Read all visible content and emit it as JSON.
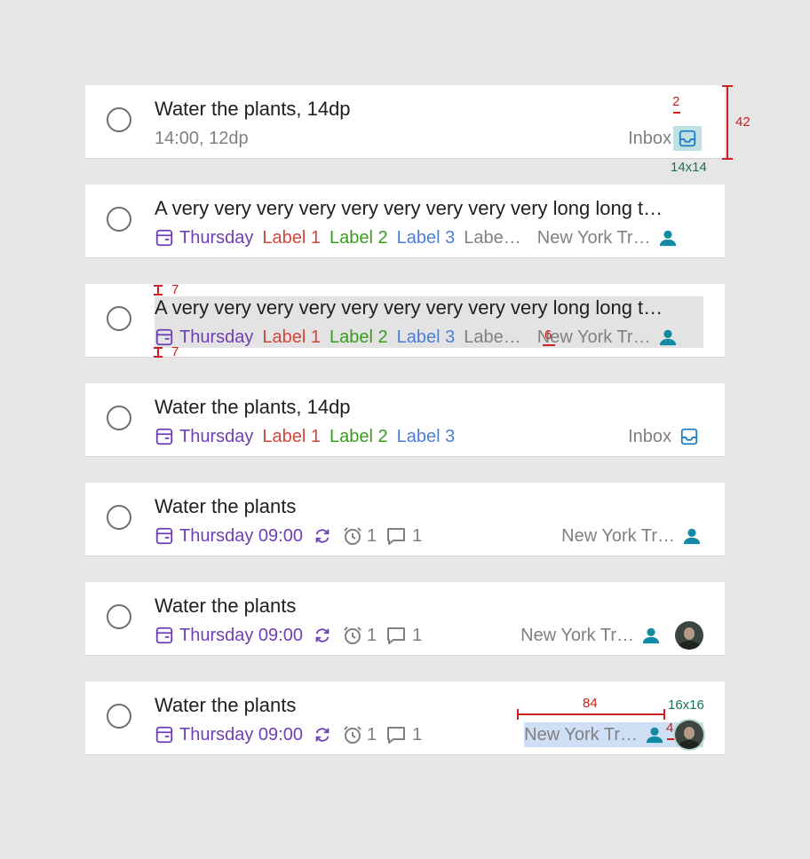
{
  "rows": [
    {
      "title": "Water the plants, 14dp",
      "time": "14:00, 12dp",
      "project": "Inbox"
    },
    {
      "title": "A very very very very very very very very very long long t…",
      "date": "Thursday",
      "labels": [
        "Label 1",
        "Label 2",
        "Label 3",
        "Labe…"
      ],
      "location": "New York Tr…"
    },
    {
      "title": "A very very very very very very very very very long long t…",
      "date": "Thursday",
      "labels": [
        "Label 1",
        "Label 2",
        "Label 3",
        "Labe…"
      ],
      "location": "New York Tr…"
    },
    {
      "title": "Water the plants, 14dp",
      "date": "Thursday",
      "labels": [
        "Label 1",
        "Label 2",
        "Label 3"
      ],
      "project": "Inbox"
    },
    {
      "title": "Water the plants",
      "date": "Thursday 09:00",
      "reminders": "1",
      "comments": "1",
      "location": "New York Tr…"
    },
    {
      "title": "Water the plants",
      "date": "Thursday 09:00",
      "reminders": "1",
      "comments": "1",
      "location": "New York Tr…"
    },
    {
      "title": "Water the plants",
      "date": "Thursday 09:00",
      "reminders": "1",
      "comments": "1",
      "location": "New York Tr…"
    }
  ],
  "annotations": {
    "icon_gap": "2",
    "row_height": "42",
    "icon_size": "14x14",
    "pad_top": "7",
    "pad_bottom": "7",
    "item_gap": "6",
    "location_width": "84",
    "avatar_gap": "4",
    "avatar_size": "16x16"
  },
  "colors": {
    "date": "#6e3fb4",
    "label1": "#d1453b",
    "label2": "#3d9a20",
    "label3": "#4a7fd8",
    "project_icon": "#1f7fc1",
    "person_icon": "#138aa3"
  }
}
